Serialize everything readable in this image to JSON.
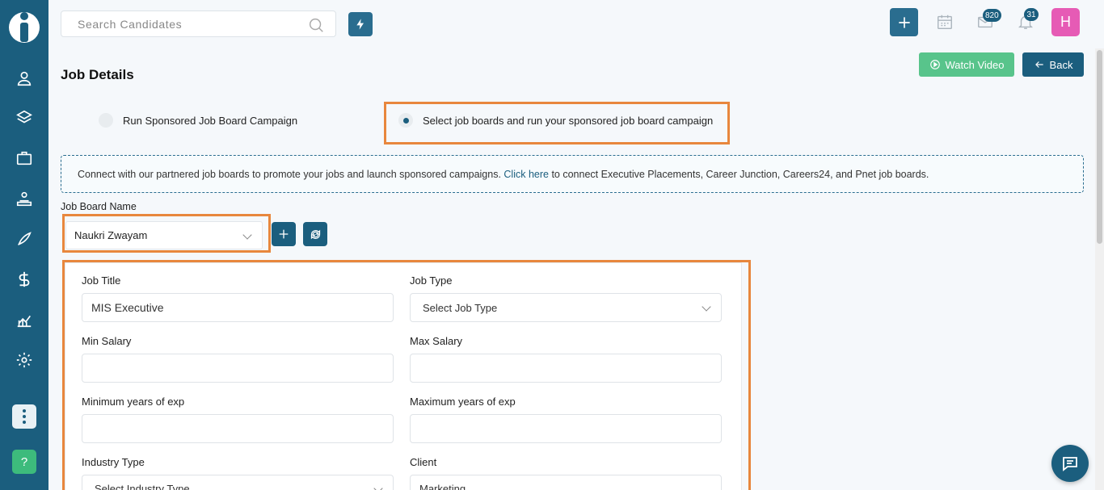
{
  "header": {
    "search_placeholder": "Search Candidates",
    "mail_badge": "820",
    "notification_badge": "31",
    "avatar_initial": "H"
  },
  "page": {
    "title": "Job Details",
    "watch_video_label": "Watch Video",
    "back_label": "Back"
  },
  "campaign_options": [
    {
      "label": "Run Sponsored Job Board Campaign",
      "selected": false
    },
    {
      "label": "Select job boards and run your sponsored job board campaign",
      "selected": true
    }
  ],
  "info": {
    "text_before": "Connect with our partnered job boards to promote your jobs and launch sponsored campaigns. ",
    "link": "Click here",
    "text_after": " to connect Executive Placements, Career Junction, Careers24, and Pnet job boards."
  },
  "job_board": {
    "label": "Job Board Name",
    "value": "Naukri Zwayam"
  },
  "form": {
    "job_title_label": "Job Title",
    "job_title_value": "MIS Executive",
    "job_type_label": "Job Type",
    "job_type_value": "Select Job Type",
    "min_salary_label": "Min Salary",
    "max_salary_label": "Max Salary",
    "min_exp_label": "Minimum years of exp",
    "max_exp_label": "Maximum years of exp",
    "industry_label": "Industry Type",
    "industry_value": "Select Industry Type",
    "client_label": "Client",
    "client_value": "Marketing"
  },
  "colors": {
    "sidebar": "#1b5e7e",
    "accent_green": "#58c48b",
    "highlight": "#e8873d",
    "avatar": "#e65bb5"
  }
}
